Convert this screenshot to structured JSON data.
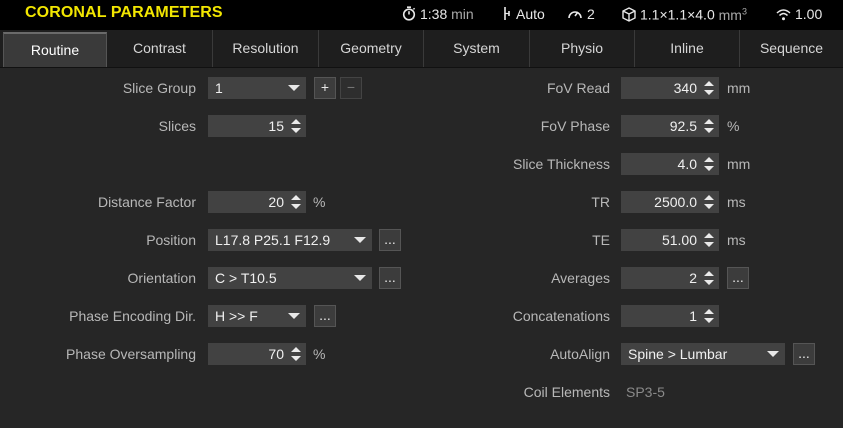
{
  "header": {
    "title": "CORONAL PARAMETERS",
    "time": "1:38",
    "time_unit": "min",
    "mode": "Auto",
    "speed": "2",
    "voxel": "1.1×1.1×4.0",
    "voxel_unit": "mm",
    "voxel_exp": "3",
    "snr": "1.00"
  },
  "tabs": [
    "Routine",
    "Contrast",
    "Resolution",
    "Geometry",
    "System",
    "Physio",
    "Inline",
    "Sequence"
  ],
  "left": {
    "slice_group": {
      "label": "Slice Group",
      "value": "1",
      "plus": "+",
      "minus": "−"
    },
    "slices": {
      "label": "Slices",
      "value": "15"
    },
    "distance_factor": {
      "label": "Distance Factor",
      "value": "20",
      "unit": "%"
    },
    "position": {
      "label": "Position",
      "value": "L17.8 P25.1 F12.9",
      "more": "..."
    },
    "orientation": {
      "label": "Orientation",
      "value": "C > T10.5",
      "more": "..."
    },
    "phase_enc_dir": {
      "label": "Phase Encoding Dir.",
      "value": "H >> F",
      "more": "..."
    },
    "phase_oversampling": {
      "label": "Phase Oversampling",
      "value": "70",
      "unit": "%"
    }
  },
  "right": {
    "fov_read": {
      "label": "FoV Read",
      "value": "340",
      "unit": "mm"
    },
    "fov_phase": {
      "label": "FoV Phase",
      "value": "92.5",
      "unit": "%"
    },
    "slice_thickness": {
      "label": "Slice Thickness",
      "value": "4.0",
      "unit": "mm"
    },
    "tr": {
      "label": "TR",
      "value": "2500.0",
      "unit": "ms"
    },
    "te": {
      "label": "TE",
      "value": "51.00",
      "unit": "ms"
    },
    "averages": {
      "label": "Averages",
      "value": "2",
      "more": "..."
    },
    "concatenations": {
      "label": "Concatenations",
      "value": "1"
    },
    "autoalign": {
      "label": "AutoAlign",
      "value": "Spine > Lumbar",
      "more": "..."
    },
    "coil_elements": {
      "label": "Coil Elements",
      "value": "SP3-5"
    }
  }
}
